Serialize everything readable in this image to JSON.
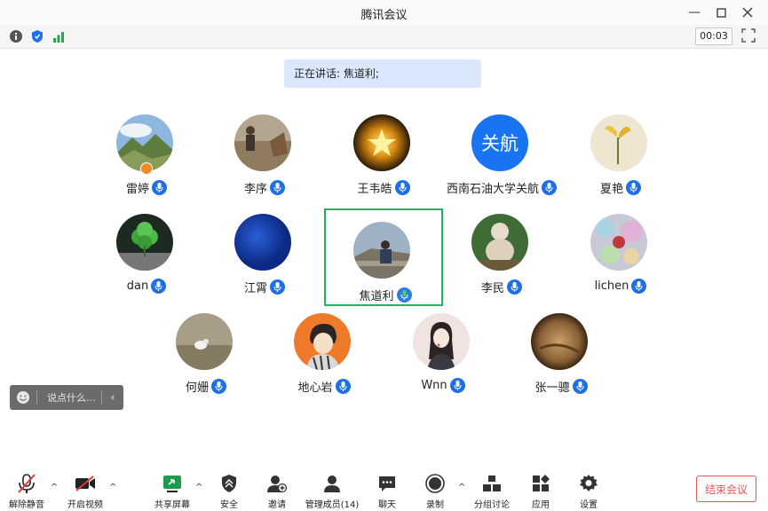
{
  "window": {
    "title": "腾讯会议"
  },
  "status": {
    "timer": "00:03"
  },
  "speaking": {
    "text": "正在讲话: 焦道利;"
  },
  "participants": [
    {
      "name": "雷婷",
      "avatar": "mountain-photo",
      "host": true
    },
    {
      "name": "李序",
      "avatar": "field-photo"
    },
    {
      "name": "王韦皓",
      "avatar": "star-lamp-photo"
    },
    {
      "name": "西南石油大学关航",
      "avatar_text": "关航",
      "avatar_color": "#1874f0"
    },
    {
      "name": "夏艳",
      "avatar": "flower-drawing"
    },
    {
      "name": "dan",
      "avatar": "clover-photo"
    },
    {
      "name": "江霄",
      "avatar": "blue-gradient"
    },
    {
      "name": "焦道利",
      "avatar": "person-wall-photo",
      "speaking": true
    },
    {
      "name": "李民",
      "avatar": "buddha-statue-photo"
    },
    {
      "name": "lichen",
      "avatar": "bokeh-photo"
    },
    {
      "name": "何姗",
      "avatar": "bird-photo"
    },
    {
      "name": "地心岩",
      "avatar": "cartoon-boy"
    },
    {
      "name": "Wnn",
      "avatar": "girl-illustration"
    },
    {
      "name": "张一骢",
      "avatar": "painting-photo"
    }
  ],
  "chat": {
    "placeholder": "说点什么..."
  },
  "toolbar": {
    "unmute": "解除静音",
    "video": "开启视频",
    "share": "共享屏幕",
    "security": "安全",
    "invite": "邀请",
    "members": "管理成员(14)",
    "chat": "聊天",
    "record": "录制",
    "breakout": "分组讨论",
    "apps": "应用",
    "settings": "设置"
  },
  "end_meeting": "结束会议",
  "colors": {
    "accent": "#1e6fe8",
    "speaking_border": "#22b361",
    "end": "#e05a5a"
  }
}
